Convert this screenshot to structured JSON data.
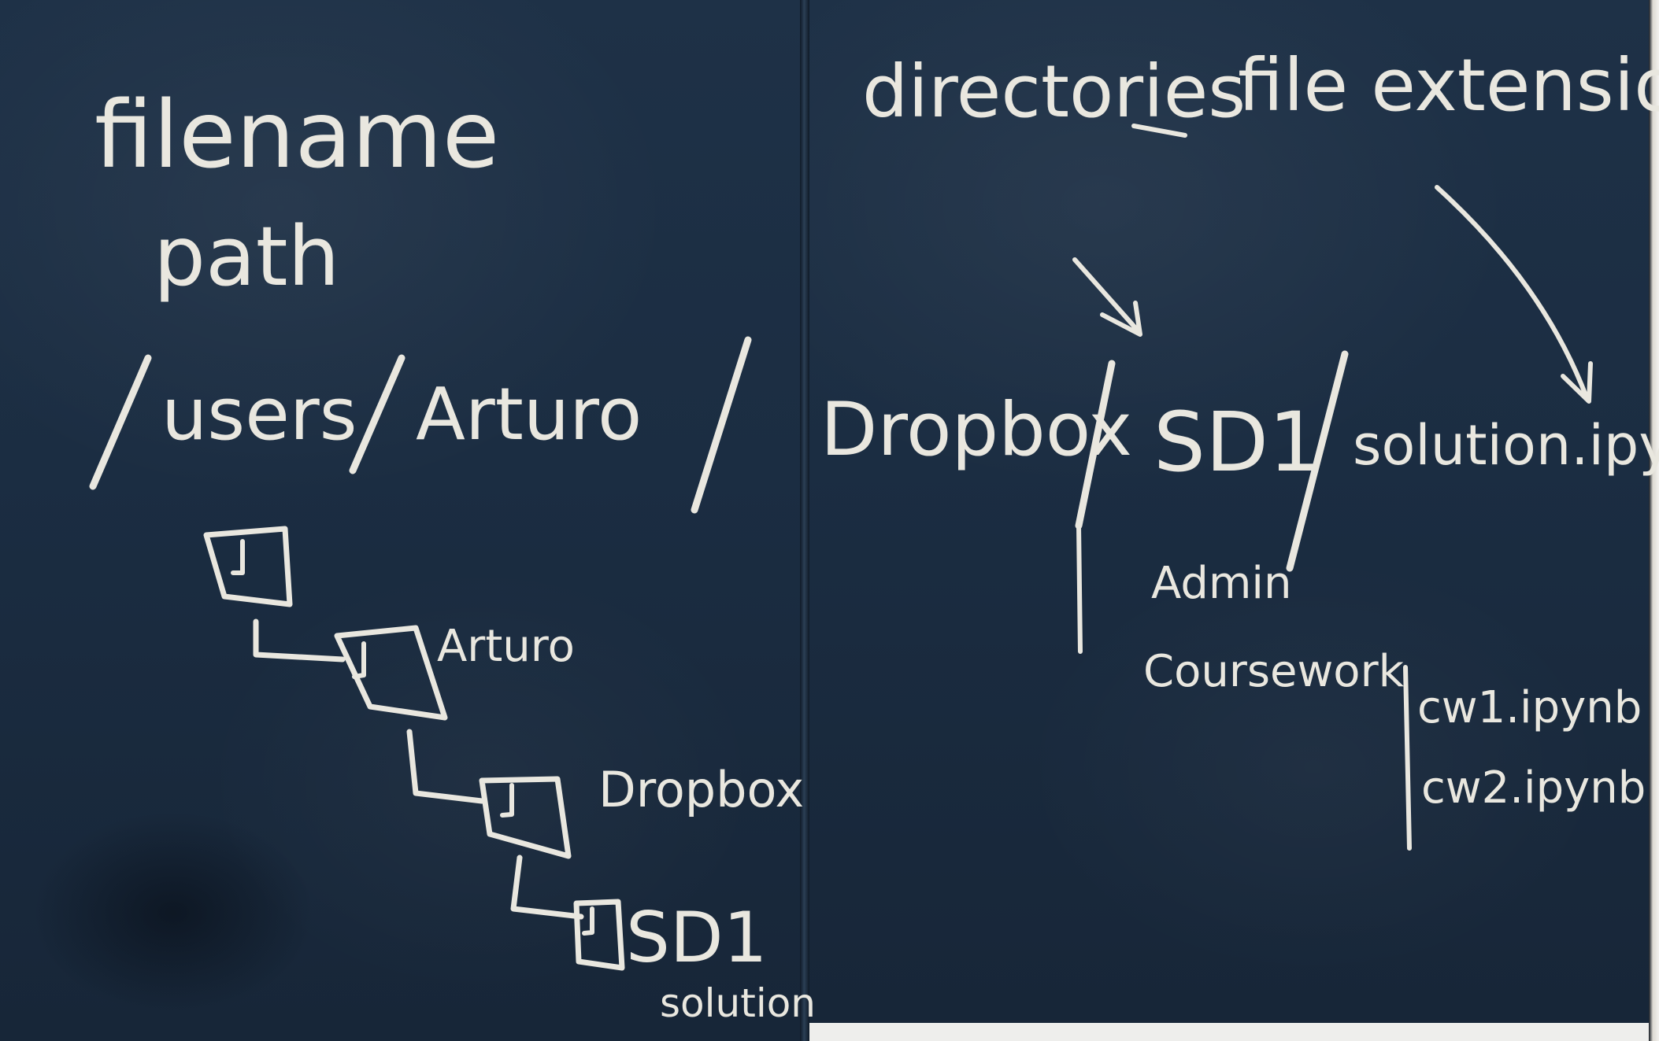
{
  "left_board": {
    "heading_filename": "filename",
    "heading_path": "path",
    "path_segments": [
      "users",
      "Arturo"
    ],
    "tree_labels": [
      "Arturo",
      "Dropbox",
      "SD1",
      "solution"
    ]
  },
  "right_board": {
    "label_directories": "directories",
    "label_file_extension": "file extension",
    "path_segments": [
      "Dropbox",
      "SD1"
    ],
    "file_name": "solution.ipynb",
    "sub_folders": [
      "Admin",
      "Coursework"
    ],
    "coursework_files": [
      "cw1.ipynb",
      "cw2.ipynb"
    ]
  },
  "colors": {
    "chalkboard": "#1b2d42",
    "chalk": "#e9e7df",
    "wall": "#eeeeec"
  }
}
